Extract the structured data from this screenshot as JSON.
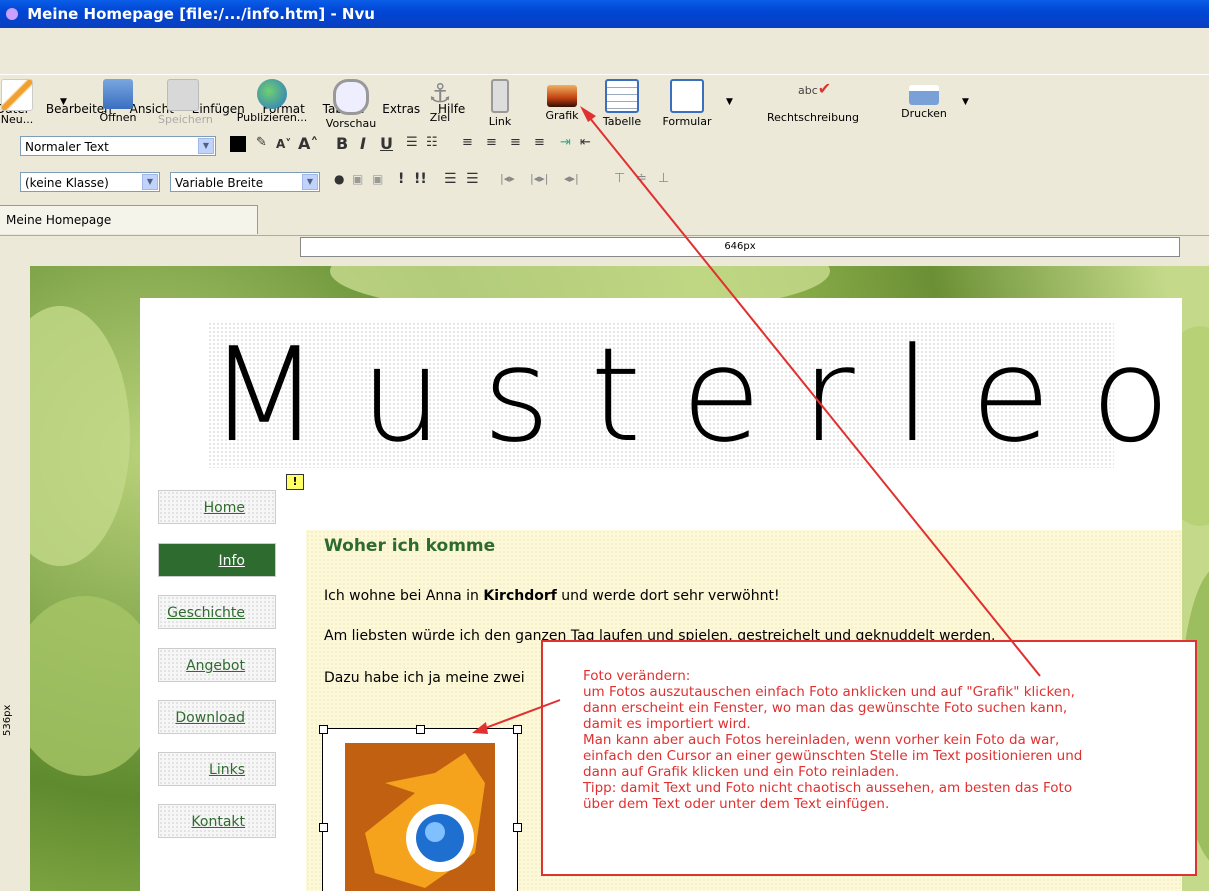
{
  "window": {
    "title": "Meine Homepage [file:/.../info.htm] - Nvu"
  },
  "menu": [
    "Datei",
    "Bearbeiten",
    "Ansicht",
    "Einfügen",
    "Format",
    "Tabelle",
    "Extras",
    "Hilfe"
  ],
  "toolbar": {
    "new": "Neu...",
    "open": "Öffnen",
    "save": "Speichern",
    "publish": "Publizieren...",
    "preview": "Vorschau",
    "anchor": "Ziel",
    "link": "Link",
    "image": "Grafik",
    "table": "Tabelle",
    "form": "Formular",
    "spell": "Rechtschreibung",
    "print": "Drucken"
  },
  "format": {
    "paragraph": "Normaler Text",
    "class": "(keine Klasse)",
    "width": "Variable Breite"
  },
  "tab": {
    "label": "Meine Homepage"
  },
  "ruler": {
    "width_label": "646px"
  },
  "side_ruler": {
    "label": "536px"
  },
  "page": {
    "logo": "Musterleo",
    "nav": [
      "Home",
      "Info",
      "Geschichte",
      "Angebot",
      "Download",
      "Links",
      "Kontakt"
    ],
    "active_nav": "Info",
    "heading": "Woher ich komme",
    "p1_pre": "Ich wohne bei Anna in ",
    "p1_bold": "Kirchdorf",
    "p1_post": " und werde dort sehr verwöhnt!",
    "p2": "Am liebsten würde ich den ganzen Tag laufen und spielen, gestreichelt und geknuddelt werden.",
    "p3": "Dazu habe ich ja meine zwei"
  },
  "callout": {
    "lines": [
      "Foto verändern:",
      "um Fotos auszutauschen einfach Foto anklicken und auf \"Grafik\" klicken,",
      "dann erscheint ein Fenster, wo man das gewünschte Foto suchen kann,",
      "damit es importiert wird.",
      "Man kann aber auch Fotos hereinladen, wenn vorher kein Foto da war,",
      "einfach den Cursor an einer gewünschten Stelle im Text positionieren und",
      "dann auf Grafik klicken und ein Foto reinladen.",
      "Tipp: damit Text und Foto nicht chaotisch aussehen, am besten das Foto",
      "über dem Text oder unter dem Text einfügen."
    ]
  },
  "colors": {
    "nav_active": "#2e6b2e",
    "callout": "#e03030",
    "titlebar": "#0046d5"
  }
}
